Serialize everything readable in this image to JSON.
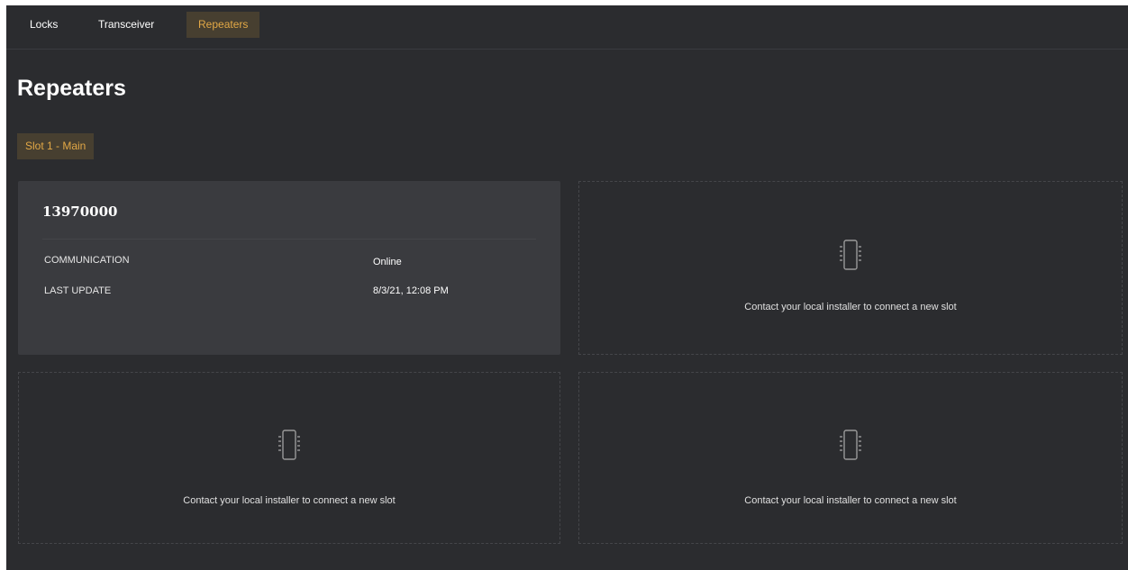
{
  "nav": {
    "tabs": [
      {
        "label": "Locks"
      },
      {
        "label": "Transceiver"
      },
      {
        "label": "Repeaters"
      }
    ]
  },
  "page": {
    "title": "Repeaters"
  },
  "slot_tabs": [
    {
      "label": "Slot 1 - Main"
    }
  ],
  "repeater": {
    "id": "13970000",
    "rows": [
      {
        "label": "COMMUNICATION",
        "value": "Online"
      },
      {
        "label": "LAST UPDATE",
        "value": "8/3/21, 12:08 PM"
      }
    ]
  },
  "empty_slots": [
    {
      "message": "Contact your local installer to connect a new slot",
      "icon": "chip-icon"
    },
    {
      "message": "Contact your local installer to connect a new slot",
      "icon": "chip-icon"
    },
    {
      "message": "Contact your local installer to connect a new slot",
      "icon": "chip-icon"
    }
  ],
  "colors": {
    "background": "#2b2c2f",
    "card": "#3a3b3f",
    "accent": "#e2a846",
    "accent_bg": "#473f30"
  }
}
